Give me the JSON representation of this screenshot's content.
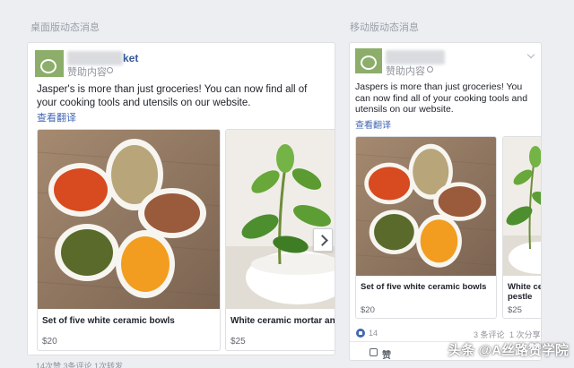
{
  "desktop": {
    "section_label": "桌面版动态消息",
    "page_name_suffix": "ket",
    "sponsored": "赞助内容",
    "ad_text": "Jasper's is more than just groceries! You can now find all of your cooking tools and utensils on our website.",
    "see_translation": "查看翻译",
    "products": [
      {
        "title": "Set of five white ceramic bowls",
        "price": "$20"
      },
      {
        "title": "White ceramic mortar and p",
        "price": "$25"
      }
    ],
    "stats": "14次赞 3条评论 1次转发"
  },
  "mobile": {
    "section_label": "移动版动态消息",
    "sponsored": "赞助内容",
    "ad_text": "Jaspers is more than just groceries! You can now find all of your cooking tools and utensils on our website.",
    "see_translation": "查看翻译",
    "products": [
      {
        "title": "Set of five white ceramic bowls",
        "price": "$20"
      },
      {
        "title": "White ce pestle",
        "price": "$25"
      }
    ],
    "likes_count": "14",
    "comments": "3 条评论",
    "shares": "1 次分享",
    "like_label": "赞"
  },
  "watermark": "头条 @A丝路赞学院",
  "colors": {
    "link": "#4267b2",
    "avatar": "#8cae6a",
    "background": "#eceef2"
  }
}
